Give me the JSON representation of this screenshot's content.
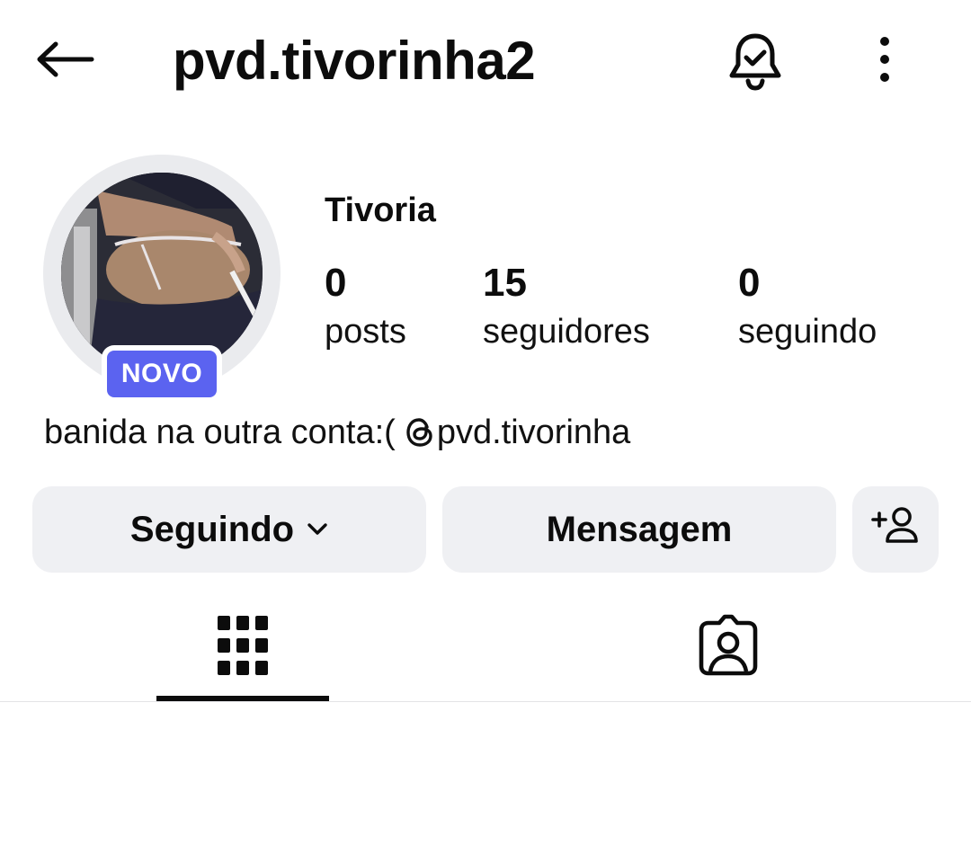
{
  "header": {
    "username": "pvd.tivorinha2",
    "icons": {
      "back": "arrow-left-icon",
      "notifications": "bell-check-icon",
      "more": "more-vertical-icon"
    }
  },
  "profile": {
    "avatar_icon": "profile-photo",
    "new_badge": "NOVO",
    "display_name": "Tivoria",
    "stats": {
      "posts": {
        "count": "0",
        "label": "posts"
      },
      "followers": {
        "count": "15",
        "label": "seguidores"
      },
      "following": {
        "count": "0",
        "label": "seguindo"
      }
    },
    "bio": {
      "text": "banida na outra conta:(",
      "mention": "pvd.tivorinha",
      "mention_icon": "threads-icon"
    }
  },
  "actions": {
    "following_label": "Seguindo",
    "message_label": "Mensagem",
    "add_person_icon": "add-person-icon"
  },
  "tabs": {
    "active": "grid",
    "items": [
      {
        "id": "grid",
        "icon": "grid-icon"
      },
      {
        "id": "tagged",
        "icon": "tagged-person-icon"
      }
    ]
  },
  "colors": {
    "accent_badge": "#5b63f0",
    "button_bg": "#eff0f3",
    "text": "#0c0c0c",
    "avatar_ring": "#eaebee"
  }
}
